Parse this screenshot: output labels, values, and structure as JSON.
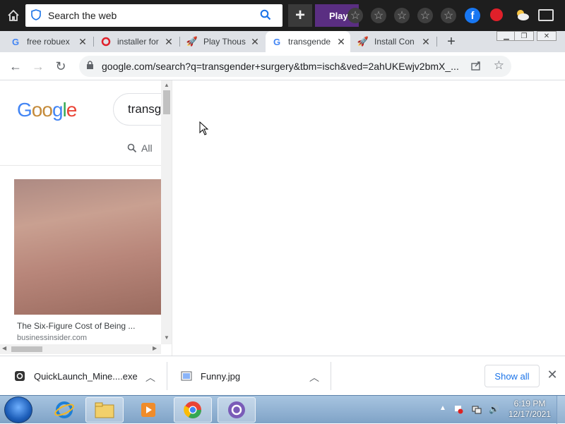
{
  "toolbar": {
    "search_placeholder": "Search the web",
    "play_label": "Play"
  },
  "tabs": [
    {
      "label": "free robuex"
    },
    {
      "label": "installer for"
    },
    {
      "label": "Play Thous"
    },
    {
      "label": "transgende"
    },
    {
      "label": "Install Con"
    }
  ],
  "address": {
    "url": "google.com/search?q=transgender+surgery&tbm=isch&ved=2ahUKEwjv2bmX_..."
  },
  "page": {
    "logo": "Google",
    "query": "transgender surgery",
    "all_tab": "All",
    "result": {
      "title": "The Six-Figure Cost of Being ...",
      "source": "businessinsider.com"
    }
  },
  "downloads": [
    {
      "name": "QuickLaunch_Mine....exe"
    },
    {
      "name": "Funny.jpg"
    }
  ],
  "download_bar": {
    "show_all": "Show all"
  },
  "taskbar": {
    "time": "6:19 PM",
    "date": "12/17/2021"
  },
  "colors": {
    "play_purple": "#5a2e82",
    "link_blue": "#1a73e8",
    "facebook": "#1877f2"
  }
}
